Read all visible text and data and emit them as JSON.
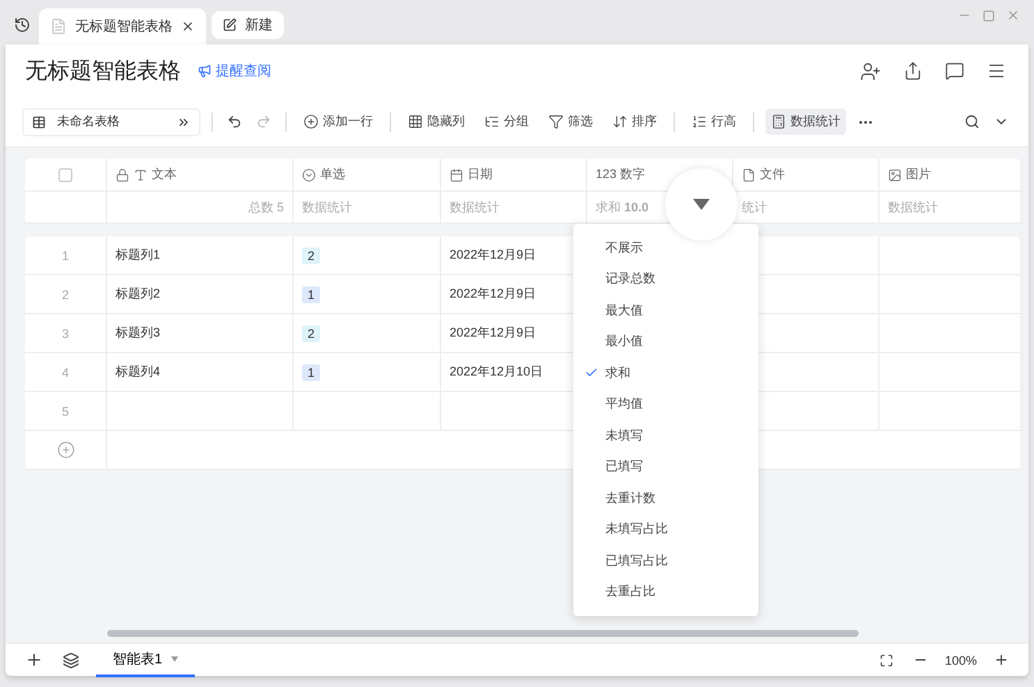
{
  "window": {
    "tabs": [
      {
        "label": "无标题智能表格",
        "selected": true
      },
      {
        "label": "新建",
        "selected": false
      }
    ]
  },
  "document": {
    "title": "无标题智能表格",
    "remind_link": "提醒查阅"
  },
  "toolbar": {
    "table_name": "未命名表格",
    "items": [
      {
        "label": "添加一行",
        "kind": "add",
        "selected": false
      },
      {
        "label": "隐藏列",
        "kind": "hide",
        "selected": false
      },
      {
        "label": "分组",
        "kind": "group",
        "selected": false
      },
      {
        "label": "筛选",
        "kind": "filter",
        "selected": false
      },
      {
        "label": "排序",
        "kind": "sort",
        "selected": false
      },
      {
        "label": "行高",
        "kind": "height",
        "selected": false
      },
      {
        "label": "数据统计",
        "kind": "stats",
        "selected": true
      }
    ]
  },
  "table": {
    "select_all": {
      "checked": false
    },
    "columns": [
      {
        "label": "文本",
        "kind": "text",
        "locked": true,
        "stat": "总数 5"
      },
      {
        "label": "单选",
        "kind": "select",
        "locked": false,
        "stat": "数据统计"
      },
      {
        "label": "日期",
        "kind": "date",
        "locked": false,
        "stat": "数据统计"
      },
      {
        "label": "数字",
        "kind": "number",
        "prefix": "123",
        "locked": false,
        "stat": "求和 **10.0**"
      },
      {
        "label": "文件",
        "kind": "file",
        "locked": false,
        "stat": "统计"
      },
      {
        "label": "图片",
        "kind": "image",
        "locked": false,
        "stat": "数据统计"
      }
    ],
    "rows": [
      {
        "number": "1",
        "text": "标题列1",
        "option": {
          "label": "2",
          "color": "#dff3fb"
        },
        "date": "2022年12月9日"
      },
      {
        "number": "2",
        "text": "标题列2",
        "option": {
          "label": "1",
          "color": "#dde8fb"
        },
        "date": "2022年12月9日"
      },
      {
        "number": "3",
        "text": "标题列3",
        "option": {
          "label": "2",
          "color": "#dff3fb"
        },
        "date": "2022年12月9日"
      },
      {
        "number": "4",
        "text": "标题列4",
        "option": {
          "label": "1",
          "color": "#dde8fb"
        },
        "date": "2022年12月10日"
      },
      {
        "number": "5"
      }
    ]
  },
  "stat_menu": {
    "items": [
      {
        "label": "不展示",
        "checked": false
      },
      {
        "label": "记录总数",
        "checked": false
      },
      {
        "label": "最大值",
        "checked": false
      },
      {
        "label": "最小值",
        "checked": false
      },
      {
        "label": "求和",
        "checked": true
      },
      {
        "label": "平均值",
        "checked": false
      },
      {
        "label": "未填写",
        "checked": false
      },
      {
        "label": "已填写",
        "checked": false
      },
      {
        "label": "去重计数",
        "checked": false
      },
      {
        "label": "未填写占比",
        "checked": false
      },
      {
        "label": "已填写占比",
        "checked": false
      },
      {
        "label": "去重占比",
        "checked": false
      }
    ]
  },
  "sheet_tabs": [
    {
      "label": "智能表1",
      "selected": true
    }
  ],
  "zoom": "100%"
}
